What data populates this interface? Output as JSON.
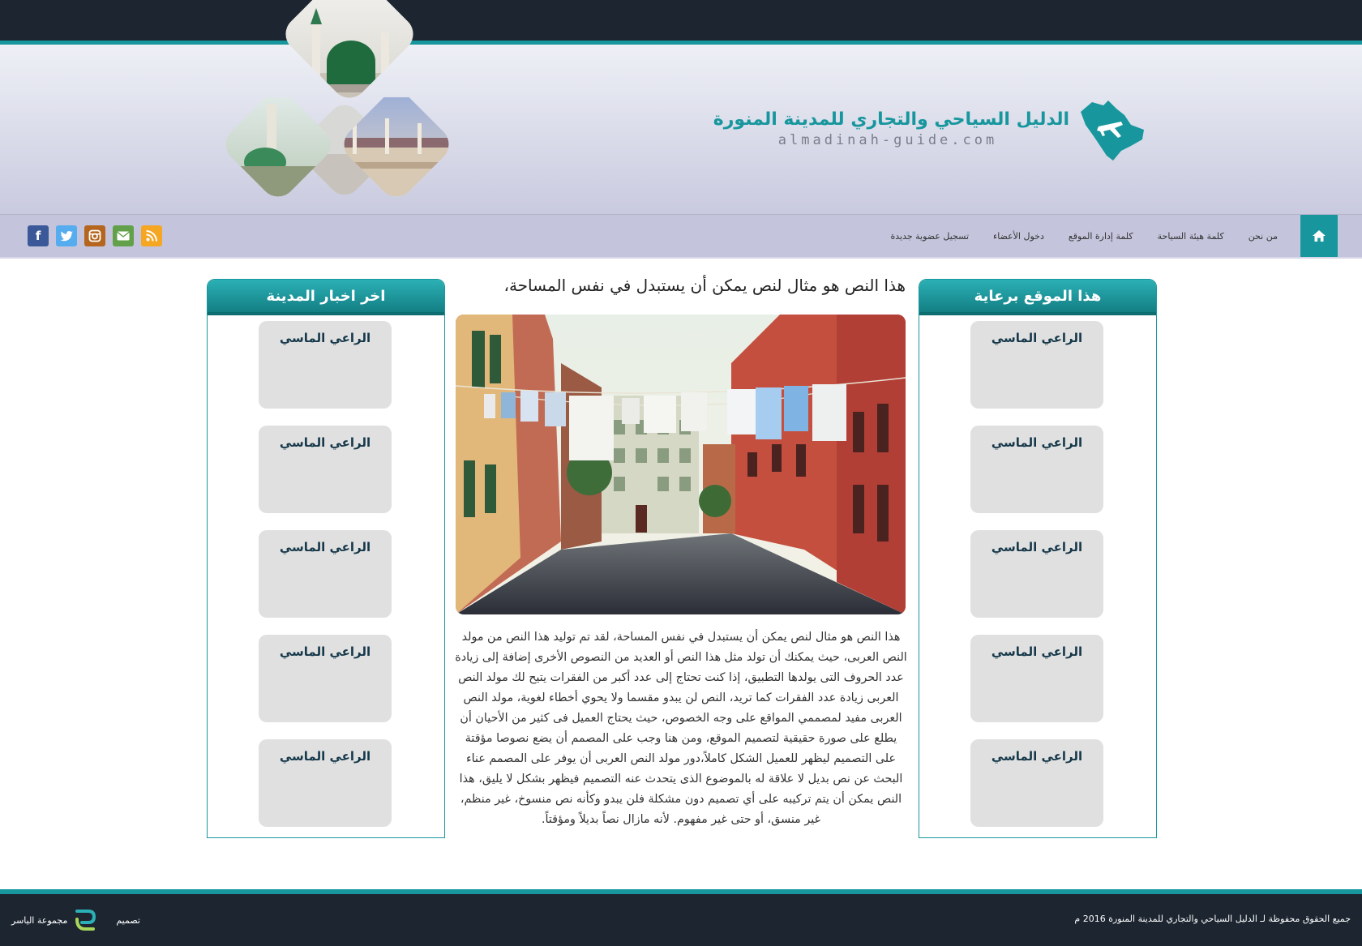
{
  "header": {
    "logo_title": "الدليل السياحي والتجاري للمدينة المنورة",
    "logo_domain": "almadinah-guide.com"
  },
  "nav": {
    "items": [
      {
        "label": "من نحن"
      },
      {
        "label": "كلمة هيئة السياحة"
      },
      {
        "label": "كلمة إدارة الموقع"
      },
      {
        "label": "دخول الأعضاء"
      },
      {
        "label": "تسجيل عضوية جديدة"
      }
    ]
  },
  "social": {
    "icons": [
      "facebook-icon",
      "twitter-icon",
      "instagram-icon",
      "email-icon",
      "rss-icon"
    ],
    "colors": {
      "facebook": "#3b5998",
      "twitter": "#55acee",
      "instagram": "#b5651d",
      "email": "#62a04a",
      "rss": "#f5a623"
    }
  },
  "right_panel": {
    "title": "هذا الموقع برعاية",
    "cards": [
      {
        "title": "الراعي الماسي"
      },
      {
        "title": "الراعي الماسي"
      },
      {
        "title": "الراعي الماسي"
      },
      {
        "title": "الراعي الماسي"
      },
      {
        "title": "الراعي الماسي"
      }
    ]
  },
  "left_panel": {
    "title": "اخر اخبار المدينة",
    "cards": [
      {
        "title": "الراعي الماسي"
      },
      {
        "title": "الراعي الماسي"
      },
      {
        "title": "الراعي الماسي"
      },
      {
        "title": "الراعي الماسي"
      },
      {
        "title": "الراعي الماسي"
      }
    ]
  },
  "article": {
    "title": "هذا النص هو مثال لنص يمكن أن يستبدل في نفس المساحة،",
    "body": "هذا النص هو مثال لنص يمكن أن يستبدل في نفس المساحة، لقد تم توليد هذا النص من مولد النص العربى، حيث يمكنك أن تولد مثل هذا النص أو العديد من النصوص الأخرى إضافة إلى زيادة عدد الحروف التى يولدها التطبيق، إذا كنت تحتاج إلى عدد أكبر من الفقرات يتيح لك مولد النص العربى زيادة عدد الفقرات كما تريد، النص لن يبدو مقسما ولا يحوي أخطاء لغوية، مولد النص العربى مفيد لمصممي المواقع على وجه الخصوص، حيث يحتاج العميل فى كثير من الأحيان أن يطلع على صورة حقيقية لتصميم الموقع، ومن هنا وجب على المصمم أن يضع نصوصا مؤقتة على التصميم ليظهر للعميل الشكل كاملاً،دور مولد النص العربى أن يوفر على المصمم عناء البحث عن نص بديل لا علاقة له بالموضوع الذى يتحدث عنه التصميم فيظهر بشكل لا يليق، هذا النص يمكن أن يتم تركيبه على أي تصميم دون مشكلة فلن يبدو وكأنه نص منسوخ، غير منظم، غير منسق، أو حتى غير مفهوم. لأنه مازال نصاً بديلاً ومؤقتاً."
  },
  "footer": {
    "copyright": "جميع الحقوق محفوظة لـ الدليل السياحي والتجاري للمدينة المنورة 2016 م",
    "design_label": "تصميم",
    "designer_name": "مجموعة الياسر"
  },
  "colors": {
    "accent": "#17979d",
    "dark": "#1c2530",
    "navbar": "#c4c5dc",
    "card": "#e0e0e0"
  }
}
